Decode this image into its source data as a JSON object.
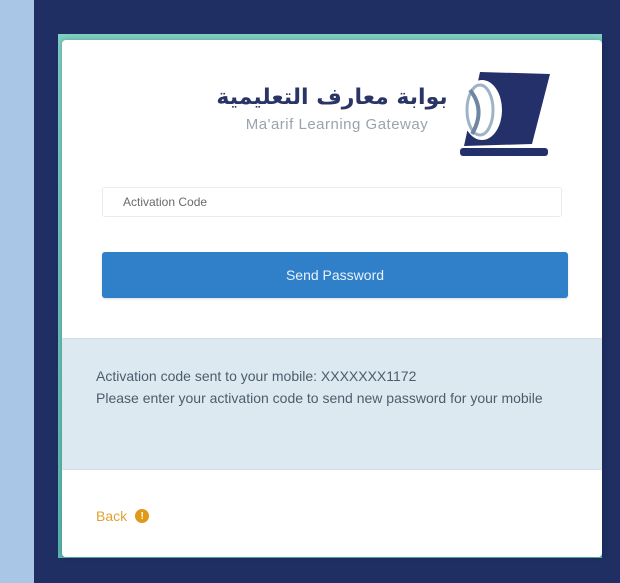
{
  "brand": {
    "name_ar": "بوابة معارف التعليمية",
    "name_en": "Ma'arif Learning Gateway",
    "logo_icon": "laptop-globe-logo-icon",
    "primary_color": "#2a3566"
  },
  "form": {
    "activation_placeholder": "Activation Code",
    "activation_value": "",
    "send_button_label": "Send Password",
    "button_color": "#2f80c8"
  },
  "alert": {
    "line1": "Activation code sent to your mobile: XXXXXXX1172",
    "line2": "Please enter your activation code to send new password for your mobile"
  },
  "footer": {
    "back_label": "Back",
    "back_icon": "info-circle-icon",
    "accent_color": "#e0a233"
  }
}
